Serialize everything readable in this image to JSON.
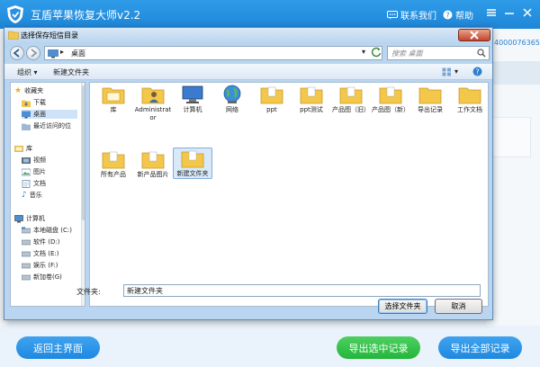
{
  "app": {
    "title": "互盾苹果恢复大师v2.2",
    "contact": "联系我们",
    "help": "帮助",
    "phone": "4000076365"
  },
  "footer": {
    "back": "返回主界面",
    "export_selected": "导出选中记录",
    "export_all": "导出全部记录"
  },
  "dialog": {
    "title": "选择保存短信目录",
    "address": "桌面",
    "search_placeholder": "搜索 桌面",
    "organize": "组织 ▾",
    "new_folder": "新建文件夹",
    "filename_label": "文件夹:",
    "filename_value": "新建文件夹",
    "ok": "选择文件夹",
    "cancel": "取消"
  },
  "nav": {
    "favorites": "收藏夹",
    "downloads": "下载",
    "desktop": "桌面",
    "recent": "最近访问的位",
    "libraries": "库",
    "videos": "视频",
    "pictures": "图片",
    "documents": "文档",
    "music": "音乐",
    "computer": "计算机",
    "drive_c": "本地磁盘 (C:)",
    "drive_d": "软件 (D:)",
    "drive_e": "文档 (E:)",
    "drive_f": "娱乐 (F:)",
    "drive_g": "新加卷(G)"
  },
  "files": [
    {
      "label": "库"
    },
    {
      "label": "Administrator"
    },
    {
      "label": "计算机"
    },
    {
      "label": "网络"
    },
    {
      "label": "ppt"
    },
    {
      "label": "ppt测试"
    },
    {
      "label": "产品图（旧）"
    },
    {
      "label": "产品图（新）"
    },
    {
      "label": "导出记录"
    },
    {
      "label": "工作文档"
    },
    {
      "label": "所有产品"
    },
    {
      "label": "新产品图片"
    },
    {
      "label": "新建文件夹"
    }
  ],
  "colors": {
    "title_bar": "#1f86d8",
    "btn_blue": "#1f88df",
    "btn_green": "#23b53b",
    "folder": "#f3c74a"
  }
}
